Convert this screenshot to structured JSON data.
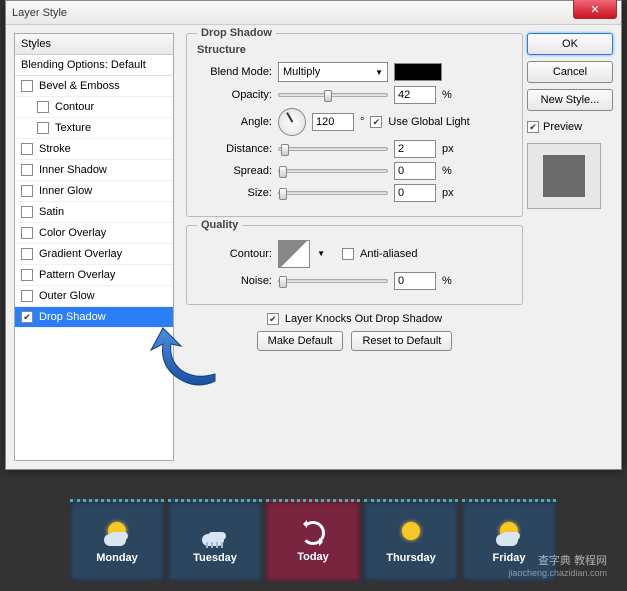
{
  "window": {
    "title": "Layer Style"
  },
  "styles": {
    "header": "Styles",
    "blending": "Blending Options: Default",
    "items": [
      {
        "label": "Bevel & Emboss",
        "checked": false,
        "indent": false,
        "selected": false
      },
      {
        "label": "Contour",
        "checked": false,
        "indent": true,
        "selected": false
      },
      {
        "label": "Texture",
        "checked": false,
        "indent": true,
        "selected": false
      },
      {
        "label": "Stroke",
        "checked": false,
        "indent": false,
        "selected": false
      },
      {
        "label": "Inner Shadow",
        "checked": false,
        "indent": false,
        "selected": false
      },
      {
        "label": "Inner Glow",
        "checked": false,
        "indent": false,
        "selected": false
      },
      {
        "label": "Satin",
        "checked": false,
        "indent": false,
        "selected": false
      },
      {
        "label": "Color Overlay",
        "checked": false,
        "indent": false,
        "selected": false
      },
      {
        "label": "Gradient Overlay",
        "checked": false,
        "indent": false,
        "selected": false
      },
      {
        "label": "Pattern Overlay",
        "checked": false,
        "indent": false,
        "selected": false
      },
      {
        "label": "Outer Glow",
        "checked": false,
        "indent": false,
        "selected": false
      },
      {
        "label": "Drop Shadow",
        "checked": true,
        "indent": false,
        "selected": true
      }
    ]
  },
  "panel": {
    "title": "Drop Shadow",
    "structure_title": "Structure",
    "blendmode_label": "Blend Mode:",
    "blendmode_value": "Multiply",
    "color": "#000000",
    "opacity_label": "Opacity:",
    "opacity_value": "42",
    "opacity_unit": "%",
    "angle_label": "Angle:",
    "angle_value": "120",
    "angle_unit": "°",
    "global_light_label": "Use Global Light",
    "global_light_checked": true,
    "distance_label": "Distance:",
    "distance_value": "2",
    "distance_unit": "px",
    "spread_label": "Spread:",
    "spread_value": "0",
    "spread_unit": "%",
    "size_label": "Size:",
    "size_value": "0",
    "size_unit": "px",
    "quality_title": "Quality",
    "contour_label": "Contour:",
    "antialiased_label": "Anti-aliased",
    "antialiased_checked": false,
    "noise_label": "Noise:",
    "noise_value": "0",
    "noise_unit": "%",
    "knockout_label": "Layer Knocks Out Drop Shadow",
    "knockout_checked": true,
    "make_default": "Make Default",
    "reset_default": "Reset to Default"
  },
  "buttons": {
    "ok": "OK",
    "cancel": "Cancel",
    "new_style": "New Style...",
    "preview": "Preview",
    "preview_checked": true
  },
  "weather": {
    "days": [
      {
        "label": "Monday",
        "icon": "sun-cloud",
        "theme": "blue"
      },
      {
        "label": "Tuesday",
        "icon": "rain",
        "theme": "blue"
      },
      {
        "label": "Today",
        "icon": "refresh",
        "theme": "red"
      },
      {
        "label": "Thursday",
        "icon": "sun",
        "theme": "blue"
      },
      {
        "label": "Friday",
        "icon": "sun-cloud",
        "theme": "blue"
      }
    ]
  },
  "watermark": {
    "line1": "查字典 教程网",
    "line2": "jiaocheng.chazidian.com"
  }
}
